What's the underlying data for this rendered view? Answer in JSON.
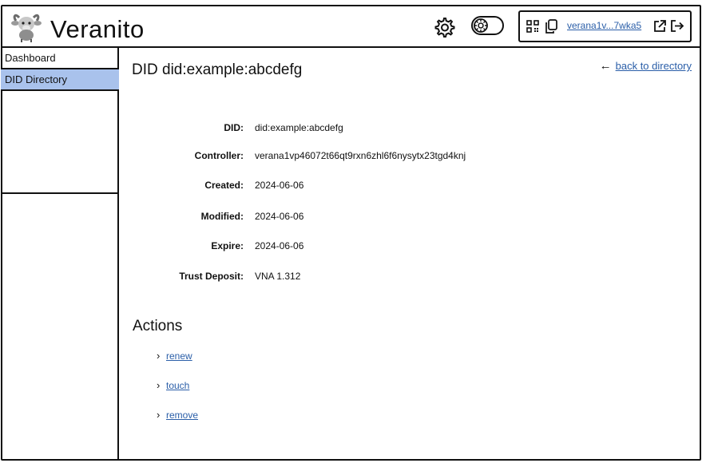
{
  "header": {
    "app_title": "Veranito",
    "logo_icon": "goat-mascot-icon",
    "settings_icon": "gear-icon",
    "toggle_icon": "network-toggle-icon",
    "account": {
      "qr_icon": "qr-code-icon",
      "copy_icon": "copy-icon",
      "address_short": "verana1v...7wka5",
      "external_icon": "external-link-icon",
      "logout_icon": "logout-icon"
    }
  },
  "sidebar": {
    "items": [
      {
        "label": "Dashboard",
        "active": false
      },
      {
        "label": "DID Directory",
        "active": true
      }
    ]
  },
  "main": {
    "title": "DID did:example:abcdefg",
    "back_link": "back to directory",
    "back_icon": "arrow-left-icon",
    "fields": [
      {
        "label": "DID:",
        "value": "did:example:abcdefg"
      },
      {
        "label": "Controller:",
        "value": "verana1vp46072t66qt9rxn6zhl6f6nysytx23tgd4knj"
      },
      {
        "label": "Created:",
        "value": "2024-06-06"
      },
      {
        "label": "Modified:",
        "value": "2024-06-06"
      },
      {
        "label": "Expire:",
        "value": "2024-06-06"
      },
      {
        "label": "Trust Deposit:",
        "value": "VNA 1.312"
      }
    ],
    "actions_title": "Actions",
    "actions": [
      {
        "label": "renew",
        "icon": "chevron-right-icon"
      },
      {
        "label": "touch",
        "icon": "chevron-right-icon"
      },
      {
        "label": "remove",
        "icon": "chevron-right-icon"
      }
    ]
  },
  "colors": {
    "link": "#2a5ea8",
    "active_sidebar": "#a9c2ec",
    "border": "#111111"
  }
}
